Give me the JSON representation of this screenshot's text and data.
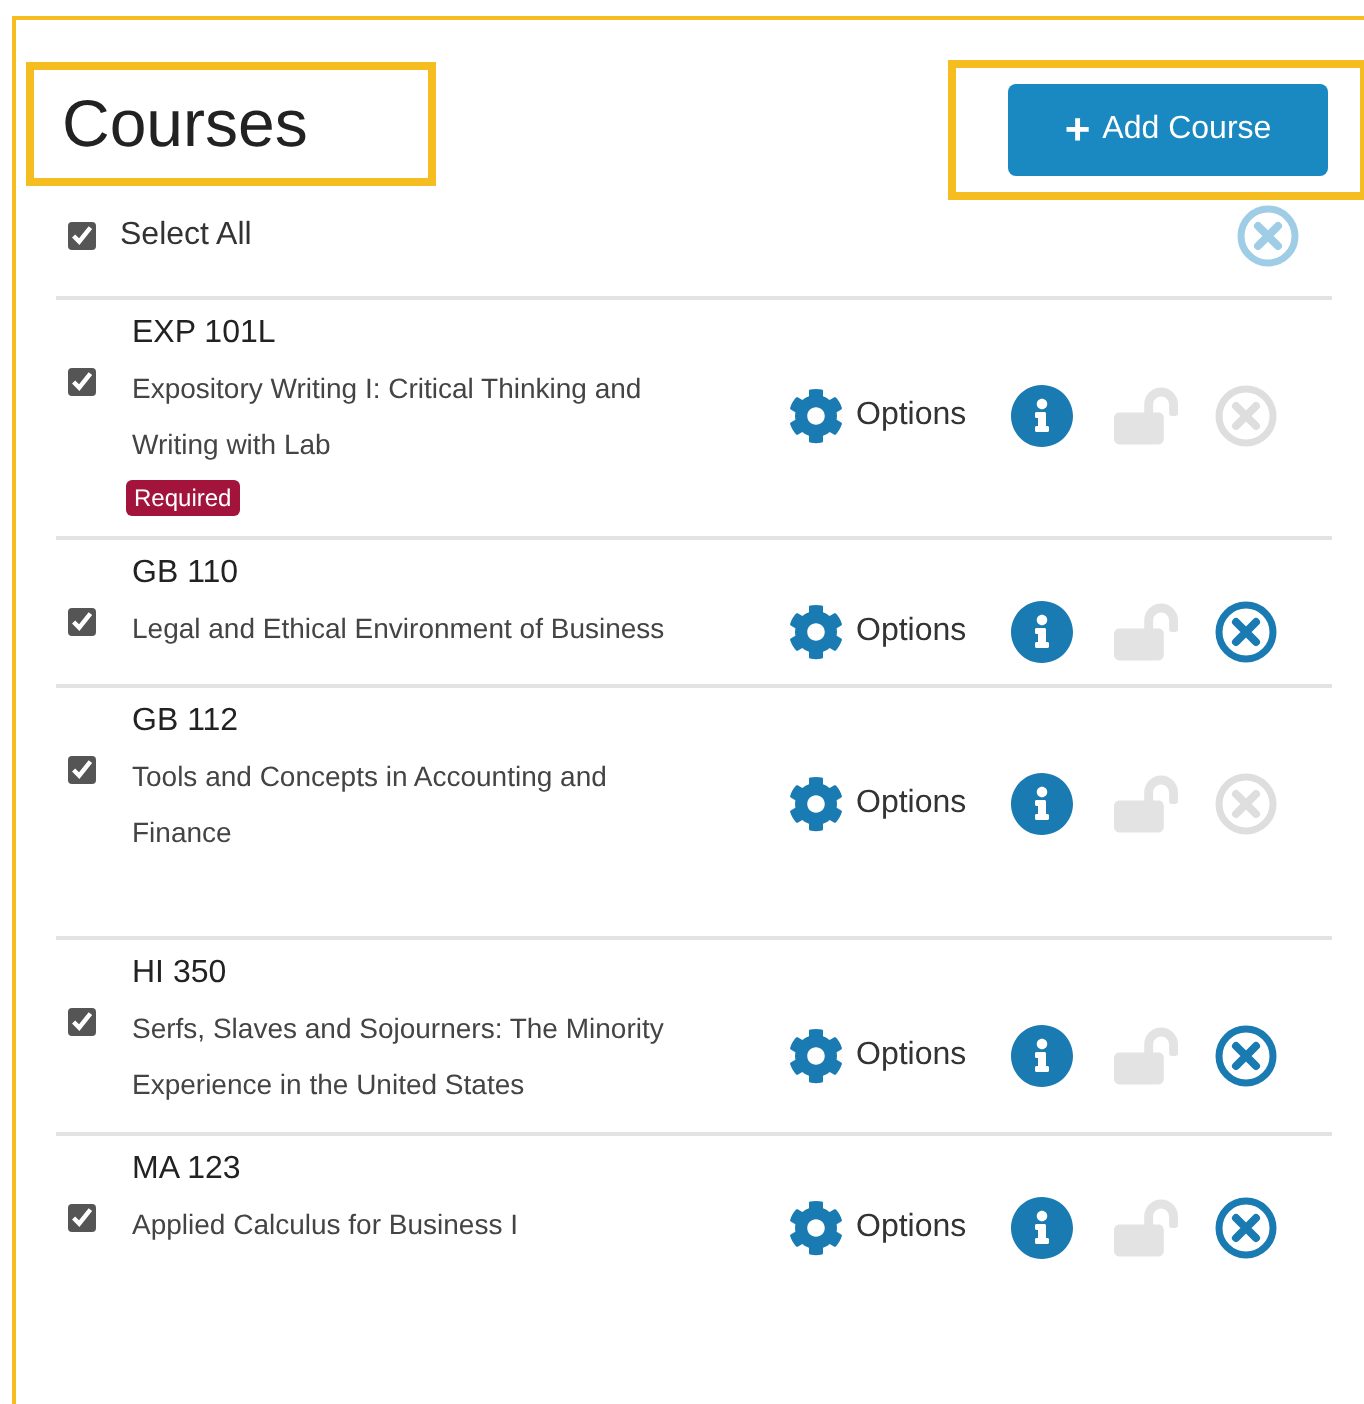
{
  "title": "Courses",
  "add_button": {
    "icon": "+",
    "label": "Add Course"
  },
  "select_all": {
    "label": "Select All",
    "checked": true,
    "remove_disabled": false
  },
  "courses": [
    {
      "code": "EXP 101L",
      "title": "Expository Writing I: Critical Thinking and Writing with Lab",
      "badge": "Required",
      "checked": true,
      "options_label": "Options",
      "lock_disabled": true,
      "remove_disabled": true
    },
    {
      "code": "GB 110",
      "title": "Legal and Ethical Environment of Business",
      "checked": true,
      "options_label": "Options",
      "lock_disabled": true,
      "remove_disabled": false
    },
    {
      "code": "GB 112",
      "title": "Tools and Concepts in Accounting and Finance",
      "checked": true,
      "options_label": "Options",
      "lock_disabled": true,
      "remove_disabled": true
    },
    {
      "code": "HI 350",
      "title": "Serfs, Slaves and Sojourners: The Minority Experience in the United States",
      "checked": true,
      "options_label": "Options",
      "lock_disabled": true,
      "remove_disabled": false
    },
    {
      "code": "MA 123",
      "title": "Applied Calculus for Business I",
      "checked": true,
      "options_label": "Options",
      "lock_disabled": true,
      "remove_disabled": false
    }
  ]
}
